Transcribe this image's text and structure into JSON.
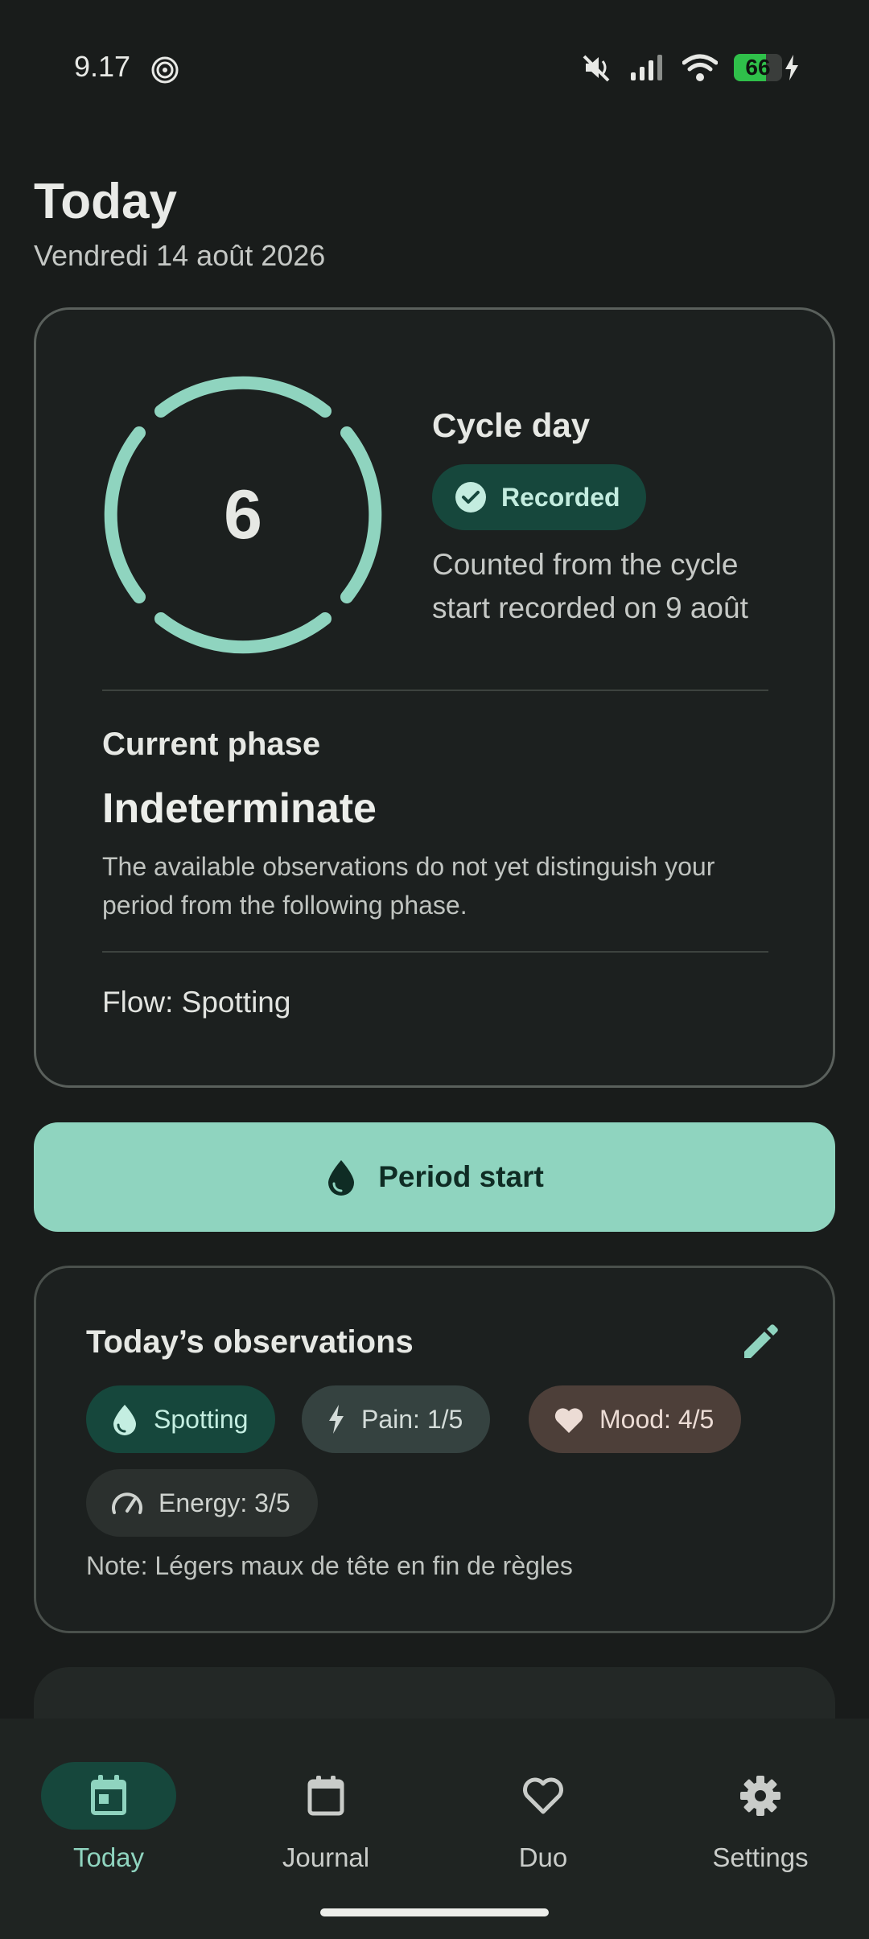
{
  "status_bar": {
    "time": "9.17",
    "battery_level": "66",
    "battery_percent": 66,
    "icons": [
      "gps-icon",
      "mute-icon",
      "signal-icon",
      "wifi-icon",
      "battery-icon",
      "charging-icon"
    ]
  },
  "header": {
    "title": "Today",
    "date": "Vendredi 14 août 2026"
  },
  "cycle_card": {
    "day_number": "6",
    "label": "Cycle day",
    "status_chip": "Recorded",
    "description": "Counted from the cycle start recorded on 9 août",
    "phase_label": "Current phase",
    "phase_value": "Indeterminate",
    "phase_description": "The available observations do not yet distinguish your period from the following phase.",
    "flow": "Flow: Spotting"
  },
  "period_button": {
    "label": "Period start",
    "icon": "drop-icon"
  },
  "observations": {
    "title": "Today’s observations",
    "edit_icon": "pencil-icon",
    "chips": [
      {
        "label": "Spotting",
        "icon": "drop-icon"
      },
      {
        "label": "Pain: 1/5",
        "icon": "lightning-icon"
      },
      {
        "label": "Mood: 4/5",
        "icon": "heart-icon"
      },
      {
        "label": "Energy: 3/5",
        "icon": "gauge-icon"
      }
    ],
    "note": "Note: Légers maux de tête en fin de règles"
  },
  "bottom_nav": {
    "items": [
      {
        "label": "Today",
        "icon": "calendar-today-icon",
        "active": true
      },
      {
        "label": "Journal",
        "icon": "calendar-icon",
        "active": false
      },
      {
        "label": "Duo",
        "icon": "heart-outline-icon",
        "active": false
      },
      {
        "label": "Settings",
        "icon": "gear-icon",
        "active": false
      }
    ]
  },
  "colors": {
    "background": "#191c1b",
    "accent": "#8fd4bf",
    "accent_container": "#16473c",
    "surface": "#1c201f"
  }
}
